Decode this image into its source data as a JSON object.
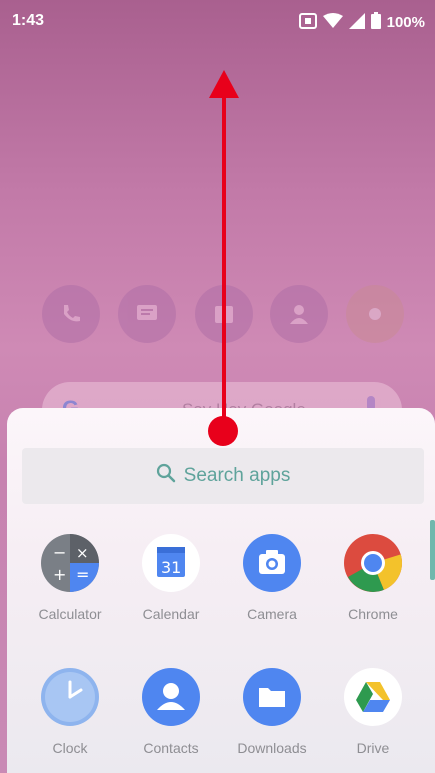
{
  "status_bar": {
    "time": "1:43",
    "battery": "100%"
  },
  "home": {
    "search_placeholder": "Say Hey Google",
    "google_letter": "G"
  },
  "drawer": {
    "search_placeholder": "Search apps",
    "apps": [
      {
        "label": "Calculator",
        "icon": "calculator-icon"
      },
      {
        "label": "Calendar",
        "icon": "calendar-icon",
        "badge": "31"
      },
      {
        "label": "Camera",
        "icon": "camera-icon"
      },
      {
        "label": "Chrome",
        "icon": "chrome-icon"
      },
      {
        "label": "Clock",
        "icon": "clock-icon"
      },
      {
        "label": "Contacts",
        "icon": "contacts-icon"
      },
      {
        "label": "Downloads",
        "icon": "downloads-icon"
      },
      {
        "label": "Drive",
        "icon": "drive-icon"
      }
    ]
  },
  "colors": {
    "accent": "#5fa39b",
    "annotation": "#e8001b"
  }
}
